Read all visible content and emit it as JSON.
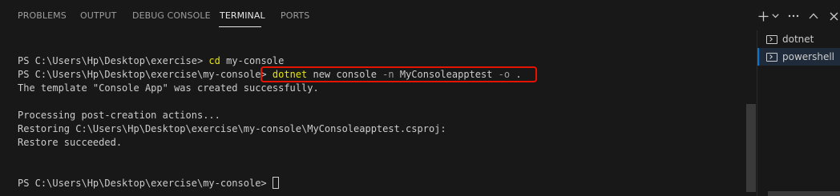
{
  "tabs": [
    {
      "label": "PROBLEMS",
      "active": false
    },
    {
      "label": "OUTPUT",
      "active": false
    },
    {
      "label": "DEBUG CONSOLE",
      "active": false
    },
    {
      "label": "TERMINAL",
      "active": true
    },
    {
      "label": "PORTS",
      "active": false
    }
  ],
  "actions": {
    "new_terminal": "plus-icon",
    "dropdown": "chevron-down-icon",
    "more": "ellipsis-icon",
    "maximize": "chevron-up-icon",
    "close": "close-icon"
  },
  "terminal": {
    "line1": {
      "prompt": "PS C:\\Users\\Hp\\Desktop\\exercise> ",
      "cmd": "cd",
      "args": " my-console"
    },
    "line2": {
      "prompt": "PS C:\\Users\\Hp\\Desktop\\exercise\\my-console> ",
      "cmd": "dotnet",
      "args1": " new console ",
      "flag1": "-n",
      "args2": " MyConsoleapptest ",
      "flag2": "-o",
      "args3": " ."
    },
    "line3": "The template \"Console App\" was created successfully.",
    "line4": "Processing post-creation actions...",
    "line5": "Restoring C:\\Users\\Hp\\Desktop\\exercise\\my-console\\MyConsoleapptest.csproj:",
    "line6": "Restore succeeded.",
    "line7": {
      "prompt": "PS C:\\Users\\Hp\\Desktop\\exercise\\my-console> "
    }
  },
  "side_terminals": [
    {
      "label": "dotnet",
      "active": false
    },
    {
      "label": "powershell",
      "active": true
    }
  ],
  "colors": {
    "background": "#181818",
    "command": "#e5e510",
    "highlight_box": "#e51400",
    "active_accent": "#0078d4"
  }
}
